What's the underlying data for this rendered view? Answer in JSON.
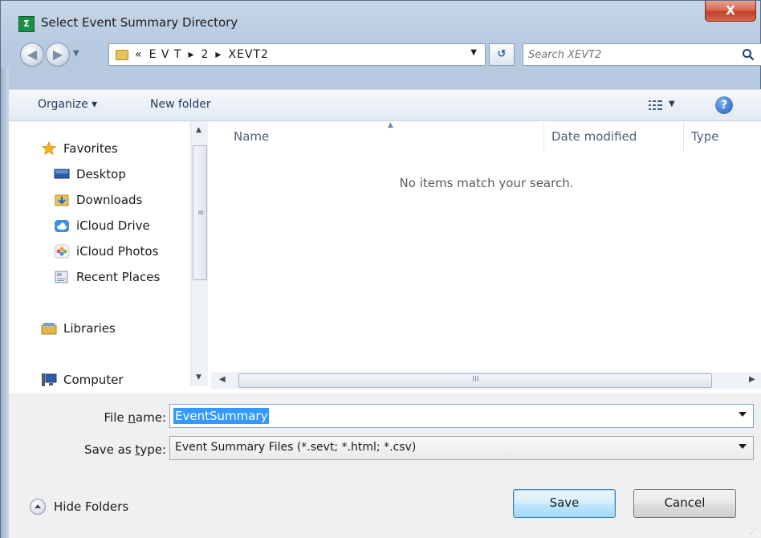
{
  "window": {
    "title": "Select Event Summary Directory",
    "close_label": "X",
    "app_icon_label": "Σ"
  },
  "address_bar": {
    "crumbs": [
      "«",
      "E V T",
      "▸",
      "2",
      "▸",
      "XEVT2"
    ],
    "refresh_icon": "refresh-icon"
  },
  "search": {
    "placeholder": "Search XEVT2"
  },
  "toolbar": {
    "organize_label": "Organize ▾",
    "new_folder_label": "New folder",
    "views_dd": "▼",
    "help_label": "?"
  },
  "nav_pane": {
    "favorites": "Favorites",
    "items": [
      {
        "label": "Desktop",
        "icon": "desktop-icon"
      },
      {
        "label": "Downloads",
        "icon": "downloads-folder-icon"
      },
      {
        "label": "iCloud Drive",
        "icon": "icloud-drive-icon"
      },
      {
        "label": "iCloud Photos",
        "icon": "icloud-photos-icon"
      },
      {
        "label": "Recent Places",
        "icon": "recent-places-icon"
      }
    ],
    "libraries": "Libraries",
    "computer": "Computer"
  },
  "file_list": {
    "columns": [
      "Name",
      "Date modified",
      "Type"
    ],
    "empty_message": "No items match your search.",
    "hscroll_grip": "III"
  },
  "form": {
    "file_name_label_pre": "File ",
    "file_name_label_key": "n",
    "file_name_label_post": "ame:",
    "file_name_value": "EventSummary",
    "save_type_label_pre": "Save as ",
    "save_type_label_key": "t",
    "save_type_label_post": "ype:",
    "save_type_value": "Event Summary Files (*.sevt; *.html; *.csv)",
    "hide_folders_label": "Hide Folders",
    "save_label": "Save",
    "cancel_label": "Cancel"
  }
}
